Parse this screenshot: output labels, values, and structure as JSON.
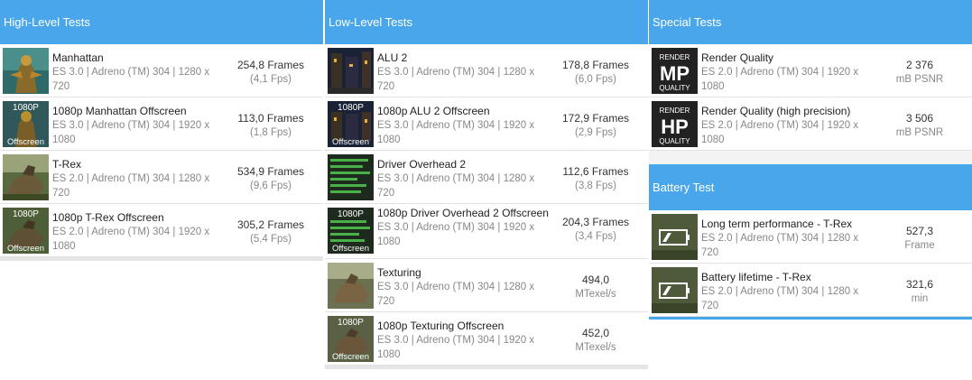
{
  "high": {
    "title": "High-Level Tests",
    "items": [
      {
        "name": "Manhattan",
        "sub": "ES 3.0 | Adreno (TM) 304 | 1280 x 720",
        "value": "254,8 Frames",
        "unit": "(4,1 Fps)"
      },
      {
        "name": "1080p Manhattan Offscreen",
        "sub": "ES 3.0 | Adreno (TM) 304 | 1920 x 1080",
        "value": "113,0 Frames",
        "unit": "(1,8 Fps)",
        "badge_top": "1080P",
        "badge_bottom": "Offscreen"
      },
      {
        "name": "T-Rex",
        "sub": "ES 2.0 | Adreno (TM) 304 | 1280 x 720",
        "value": "534,9 Frames",
        "unit": "(9,6 Fps)"
      },
      {
        "name": "1080p T-Rex Offscreen",
        "sub": "ES 2.0 | Adreno (TM) 304 | 1920 x 1080",
        "value": "305,2 Frames",
        "unit": "(5,4 Fps)",
        "badge_top": "1080P",
        "badge_bottom": "Offscreen"
      }
    ]
  },
  "low": {
    "title": "Low-Level Tests",
    "items": [
      {
        "name": "ALU 2",
        "sub": "ES 3.0 | Adreno (TM) 304 | 1280 x 720",
        "value": "178,8 Frames",
        "unit": "(6,0 Fps)"
      },
      {
        "name": "1080p ALU 2 Offscreen",
        "sub": "ES 3.0 | Adreno (TM) 304 | 1920 x 1080",
        "value": "172,9 Frames",
        "unit": "(2,9 Fps)",
        "badge_top": "1080P",
        "badge_bottom": "Offscreen"
      },
      {
        "name": "Driver Overhead 2",
        "sub": "ES 3.0 | Adreno (TM) 304 | 1280 x 720",
        "value": "112,6 Frames",
        "unit": "(3,8 Fps)"
      },
      {
        "name": "1080p Driver Overhead 2 Offscreen",
        "sub": "ES 3.0 | Adreno (TM) 304 | 1920 x 1080",
        "value": "204,3 Frames",
        "unit": "(3,4 Fps)",
        "badge_top": "1080P",
        "badge_bottom": "Offscreen"
      },
      {
        "name": "Texturing",
        "sub": "ES 3.0 | Adreno (TM) 304 | 1280 x 720",
        "value": "494,0",
        "unit": "MTexel/s"
      },
      {
        "name": "1080p Texturing Offscreen",
        "sub": "ES 3.0 | Adreno (TM) 304 | 1920 x 1080",
        "value": "452,0",
        "unit": "MTexel/s",
        "badge_top": "1080P",
        "badge_bottom": "Offscreen"
      }
    ]
  },
  "special": {
    "title": "Special Tests",
    "items": [
      {
        "name": "Render Quality",
        "sub": "ES 2.0 | Adreno (TM) 304 | 1920 x 1080",
        "value": "2 376",
        "unit": "mB PSNR",
        "icon_top": "RENDER",
        "icon_mid": "MP",
        "icon_bottom": "QUALITY"
      },
      {
        "name": "Render Quality (high precision)",
        "sub": "ES 2.0 | Adreno (TM) 304 | 1920 x 1080",
        "value": "3 506",
        "unit": "mB PSNR",
        "icon_top": "RENDER",
        "icon_mid": "HP",
        "icon_bottom": "QUALITY"
      }
    ]
  },
  "battery": {
    "title": "Battery Test",
    "items": [
      {
        "name": "Long term performance - T-Rex",
        "sub": "ES 2.0 | Adreno (TM) 304 | 1280 x 720",
        "value": "527,3",
        "unit": "Frame"
      },
      {
        "name": "Battery lifetime - T-Rex",
        "sub": "ES 2.0 | Adreno (TM) 304 | 1280 x 720",
        "value": "321,6",
        "unit": "min"
      }
    ]
  },
  "colors": {
    "header": "#4aa6ea",
    "border": "#e2e2e2"
  }
}
